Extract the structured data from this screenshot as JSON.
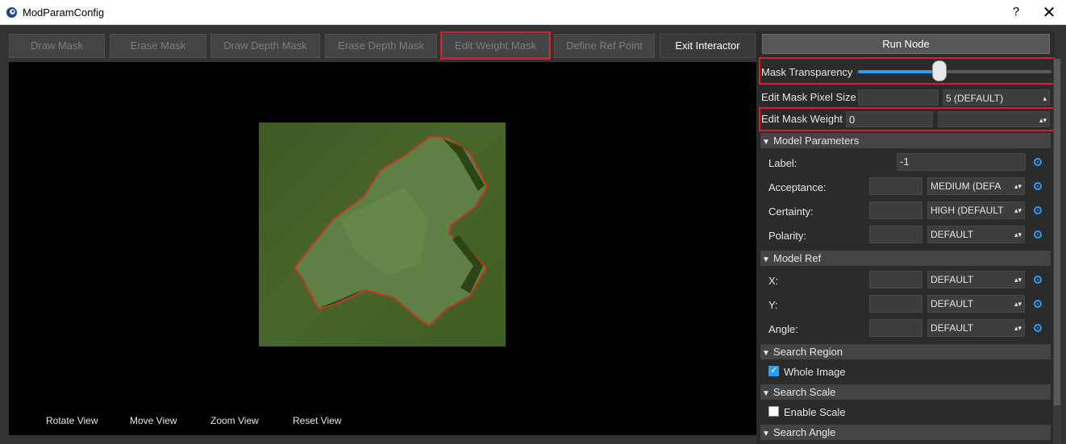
{
  "window": {
    "title": "ModParamConfig",
    "help_label": "?",
    "close_label": "✕"
  },
  "toolbar": [
    {
      "label": "Draw Mask",
      "enabled": false
    },
    {
      "label": "Erase Mask",
      "enabled": false
    },
    {
      "label": "Draw Depth Mask",
      "enabled": false
    },
    {
      "label": "Erase Depth Mask",
      "enabled": false
    },
    {
      "label": "Edit Weight Mask",
      "enabled": false,
      "highlighted": true
    },
    {
      "label": "Define Ref Point",
      "enabled": false
    },
    {
      "label": "Exit Interactor",
      "enabled": true
    }
  ],
  "view_controls": [
    "Rotate View",
    "Move View",
    "Zoom View",
    "Reset View"
  ],
  "panel": {
    "run_button": "Run Node",
    "mask_transparency": {
      "label": "Mask Transparency",
      "value": 0.42
    },
    "edit_mask_pixel_size": {
      "label": "Edit Mask Pixel Size",
      "value": "",
      "option": "5 (DEFAULT)"
    },
    "edit_mask_weight": {
      "label": "Edit Mask Weight",
      "value": "0",
      "option": ""
    },
    "model_parameters": {
      "header": "Model Parameters",
      "rows": [
        {
          "label": "Label:",
          "value": "-1",
          "option": null
        },
        {
          "label": "Acceptance:",
          "value": "",
          "option": "MEDIUM (DEFA"
        },
        {
          "label": "Certainty:",
          "value": "",
          "option": "HIGH (DEFAULT"
        },
        {
          "label": "Polarity:",
          "value": "",
          "option": "DEFAULT"
        }
      ]
    },
    "model_ref": {
      "header": "Model Ref",
      "rows": [
        {
          "label": "X:",
          "value": "",
          "option": "DEFAULT"
        },
        {
          "label": "Y:",
          "value": "",
          "option": "DEFAULT"
        },
        {
          "label": "Angle:",
          "value": "",
          "option": "DEFAULT"
        }
      ]
    },
    "search_region": {
      "header": "Search Region",
      "checkbox_label": "Whole Image",
      "checked": true
    },
    "search_scale": {
      "header": "Search Scale",
      "checkbox_label": "Enable Scale",
      "checked": false
    },
    "search_angle": {
      "header": "Search Angle"
    }
  },
  "colors": {
    "accent": "#2a9df4",
    "highlight": "#d7202a",
    "mask_outline": "#c0391b"
  },
  "icons": {
    "app": "eye-logo-icon",
    "section_expanded": "triangle-down-icon",
    "combo_arrow": "updown-arrow-icon",
    "param_link": "radio-target-icon"
  }
}
